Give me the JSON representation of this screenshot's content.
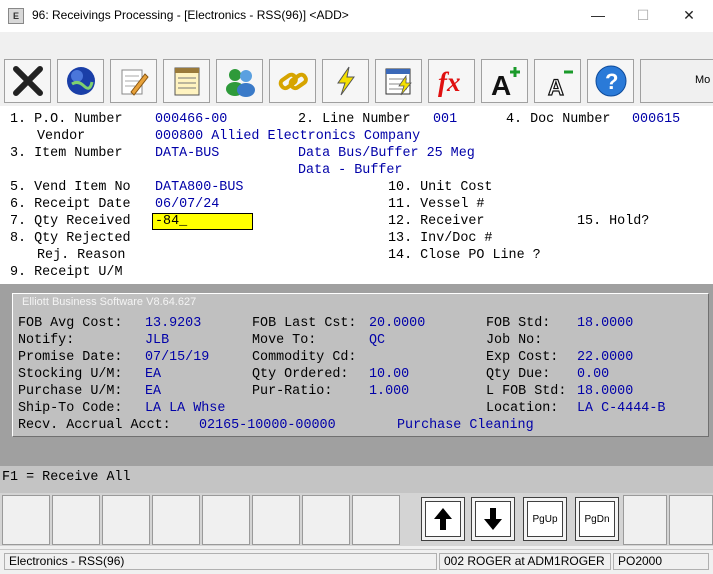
{
  "window": {
    "app_icon": "E",
    "title": "96: Receivings Processing - [Electronics - RSS(96)] <ADD>",
    "minimize": "—",
    "maximize": "☐",
    "close": "✕"
  },
  "toolbar": {
    "icons": [
      "exit-x-icon",
      "globe-icon",
      "notepad-pencil-icon",
      "ledger-icon",
      "users-icon",
      "chain-link-icon",
      "lightning-icon",
      "calendar-lightning-icon",
      "fx-function-icon",
      "font-increase-icon",
      "font-decrease-icon",
      "help-icon"
    ],
    "more_label": "Mo"
  },
  "form": {
    "f1": {
      "label": "1. P.O. Number",
      "value": "000466-00"
    },
    "f2": {
      "label": "2. Line Number",
      "value": "001"
    },
    "f4": {
      "label": "4. Doc Number",
      "value": "000615"
    },
    "vendor": {
      "label": "Vendor",
      "value": "000800 Allied Electronics Company"
    },
    "f3": {
      "label": "3. Item Number",
      "value": "DATA-BUS",
      "desc1": "Data Bus/Buffer 25 Meg",
      "desc2": "Data - Buffer"
    },
    "f5": {
      "label": "5. Vend Item No",
      "value": "DATA800-BUS"
    },
    "f6": {
      "label": "6. Receipt Date",
      "value": "06/07/24"
    },
    "f7": {
      "label": "7. Qty Received",
      "value": "-84_"
    },
    "f8": {
      "label": "8. Qty Rejected"
    },
    "rej": {
      "label": "Rej. Reason"
    },
    "f9": {
      "label": "9. Receipt U/M"
    },
    "f10": {
      "label": "10. Unit Cost"
    },
    "f11": {
      "label": "11. Vessel #"
    },
    "f12": {
      "label": "12. Receiver"
    },
    "f13": {
      "label": "13. Inv/Doc #"
    },
    "f14": {
      "label": "14. Close PO Line ?"
    },
    "f15": {
      "label": "15. Hold?"
    }
  },
  "panel": {
    "title": "Elliott Business Software V8.64.627",
    "fob_avg_cost": {
      "label": "FOB Avg Cost:",
      "value": "13.9203"
    },
    "fob_last_cst": {
      "label": "FOB Last Cst:",
      "value": "20.0000"
    },
    "fob_std": {
      "label": "FOB Std:",
      "value": "18.0000"
    },
    "notify": {
      "label": "Notify:",
      "value": "JLB"
    },
    "move_to": {
      "label": "Move To:",
      "value": "QC"
    },
    "job_no": {
      "label": "Job No:",
      "value": ""
    },
    "promise_date": {
      "label": "Promise Date:",
      "value": "07/15/19"
    },
    "commodity_cd": {
      "label": "Commodity Cd:",
      "value": ""
    },
    "exp_cost": {
      "label": "Exp Cost:",
      "value": "22.0000"
    },
    "stocking_um": {
      "label": "Stocking U/M:",
      "value": "EA"
    },
    "qty_ordered": {
      "label": "Qty Ordered:",
      "value": "10.00"
    },
    "qty_due": {
      "label": "Qty Due:",
      "value": "0.00"
    },
    "purchase_um": {
      "label": "Purchase U/M:",
      "value": "EA"
    },
    "pur_ratio": {
      "label": "Pur-Ratio:",
      "value": "1.000"
    },
    "l_fob_std": {
      "label": "L FOB Std:",
      "value": "18.0000"
    },
    "ship_to": {
      "label": "Ship-To Code:",
      "value": "LA LA Whse"
    },
    "location": {
      "label": "Location:",
      "value": "LA C-4444-B"
    },
    "recv_accrual": {
      "label": "Recv. Accrual Acct:",
      "value": "02165-10000-00000",
      "desc": "Purchase Cleaning"
    }
  },
  "fkey_line": "F1 = Receive All",
  "nav_buttons": {
    "up": "↑",
    "down": "↓",
    "pgup": "PgUp",
    "pgdn": "PgDn"
  },
  "status": {
    "company": "Electronics - RSS(96)",
    "user": "002 ROGER at ADM1ROGER",
    "program": "PO2000"
  },
  "colors": {
    "label": "#000000",
    "value": "#0000a8",
    "input_bg": "#ffff00",
    "panel": "#c0c0c0"
  }
}
